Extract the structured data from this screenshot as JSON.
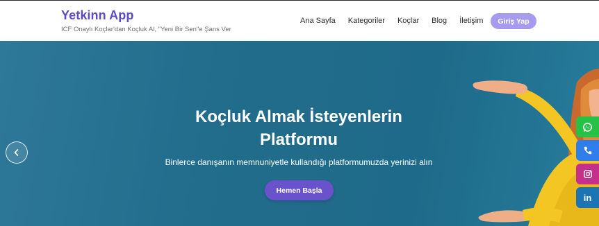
{
  "header": {
    "brand_title": "Yetkinn App",
    "brand_tagline": "ICF Onaylı Koçlar'dan Koçluk Al, \"Yeni Bir Sen\"e Şans Ver",
    "nav": [
      {
        "label": "Ana Sayfa"
      },
      {
        "label": "Kategoriler"
      },
      {
        "label": "Koçlar"
      },
      {
        "label": "Blog"
      },
      {
        "label": "İletişim"
      }
    ],
    "login_label": "Giriş Yap"
  },
  "hero": {
    "title_line1": "Koçluk Almak İsteyenlerin",
    "title_line2": "Platformu",
    "subtitle": "Binlerce danışanın memnuniyetle kullandığı platformumuzda yerinizi alın",
    "cta_label": "Hemen Başla"
  },
  "social": [
    {
      "icon": "whatsapp-icon"
    },
    {
      "icon": "phone-icon"
    },
    {
      "icon": "instagram-icon"
    },
    {
      "icon": "linkedin-icon",
      "text": "in"
    }
  ],
  "colors": {
    "brand": "#5b4ac4",
    "login_button": "#a79bf0",
    "cta_button": "#6a52cc",
    "hero_bg": "#23718f",
    "whatsapp": "#26c245",
    "phone": "#2f7ee9",
    "instagram": "#c5318a",
    "linkedin": "#1d74b3"
  }
}
